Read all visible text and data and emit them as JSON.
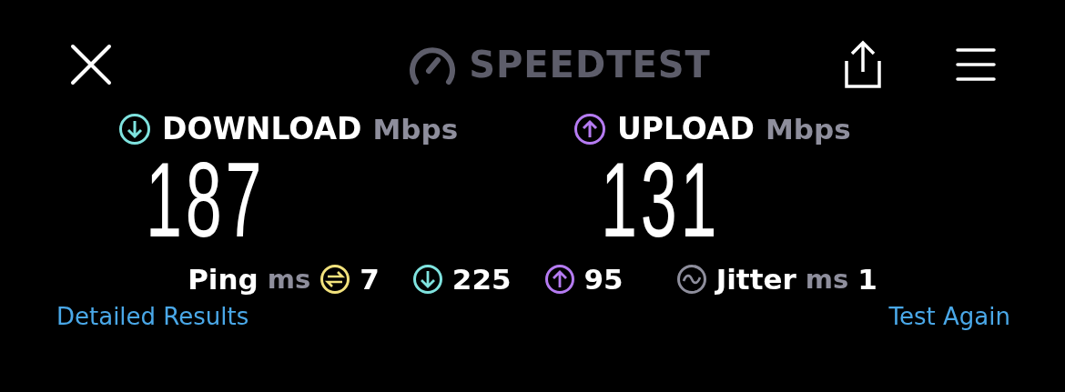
{
  "header": {
    "logo": "SPEEDTEST"
  },
  "results": [
    {
      "kind": "download",
      "label": "DOWNLOAD",
      "unit": "Mbps",
      "value": "187"
    },
    {
      "kind": "upload",
      "label": "UPLOAD",
      "unit": "Mbps",
      "value": "131"
    }
  ],
  "ping": {
    "label": "Ping",
    "unit": "ms",
    "idle": "7",
    "download": "225",
    "upload": "95"
  },
  "jitter": {
    "label": "Jitter",
    "unit": "ms",
    "value": "1"
  },
  "links": [
    "Detailed Results",
    "Test Again"
  ]
}
